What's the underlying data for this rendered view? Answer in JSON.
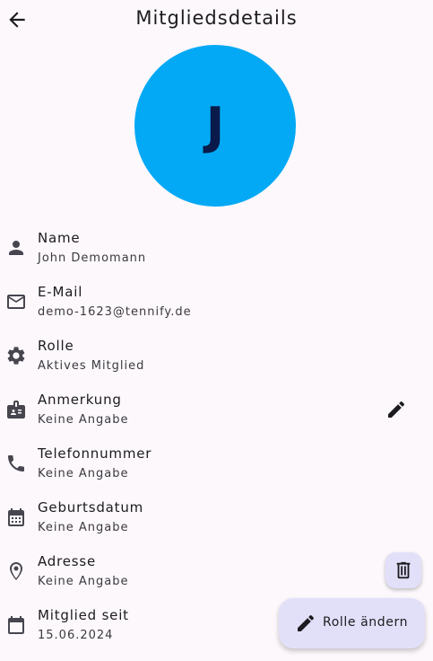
{
  "header": {
    "title": "Mitgliedsdetails",
    "back_icon": "arrow-back-icon"
  },
  "avatar": {
    "initial": "J",
    "background": "#03a9f4",
    "text_color": "#0a1a4a"
  },
  "details": [
    {
      "icon": "person-icon",
      "label": "Name",
      "value": "John Demomann"
    },
    {
      "icon": "mail-icon",
      "label": "E-Mail",
      "value": "demo-1623@tennify.de"
    },
    {
      "icon": "gear-icon",
      "label": "Rolle",
      "value": "Aktives Mitglied"
    },
    {
      "icon": "badge-icon",
      "label": "Anmerkung",
      "value": "Keine Angabe"
    },
    {
      "icon": "phone-icon",
      "label": "Telefonnummer",
      "value": "Keine Angabe"
    },
    {
      "icon": "calendar-icon",
      "label": "Geburtsdatum",
      "value": "Keine Angabe"
    },
    {
      "icon": "location-icon",
      "label": "Adresse",
      "value": "Keine Angabe"
    },
    {
      "icon": "calendar-blank-icon",
      "label": "Mitglied seit",
      "value": "15.06.2024"
    }
  ],
  "actions": {
    "edit_note_icon": "pencil-icon",
    "delete_icon": "trash-icon",
    "change_role_label": "Rolle ändern",
    "change_role_icon": "pencil-icon",
    "fab_color": "#e2e0f9"
  }
}
